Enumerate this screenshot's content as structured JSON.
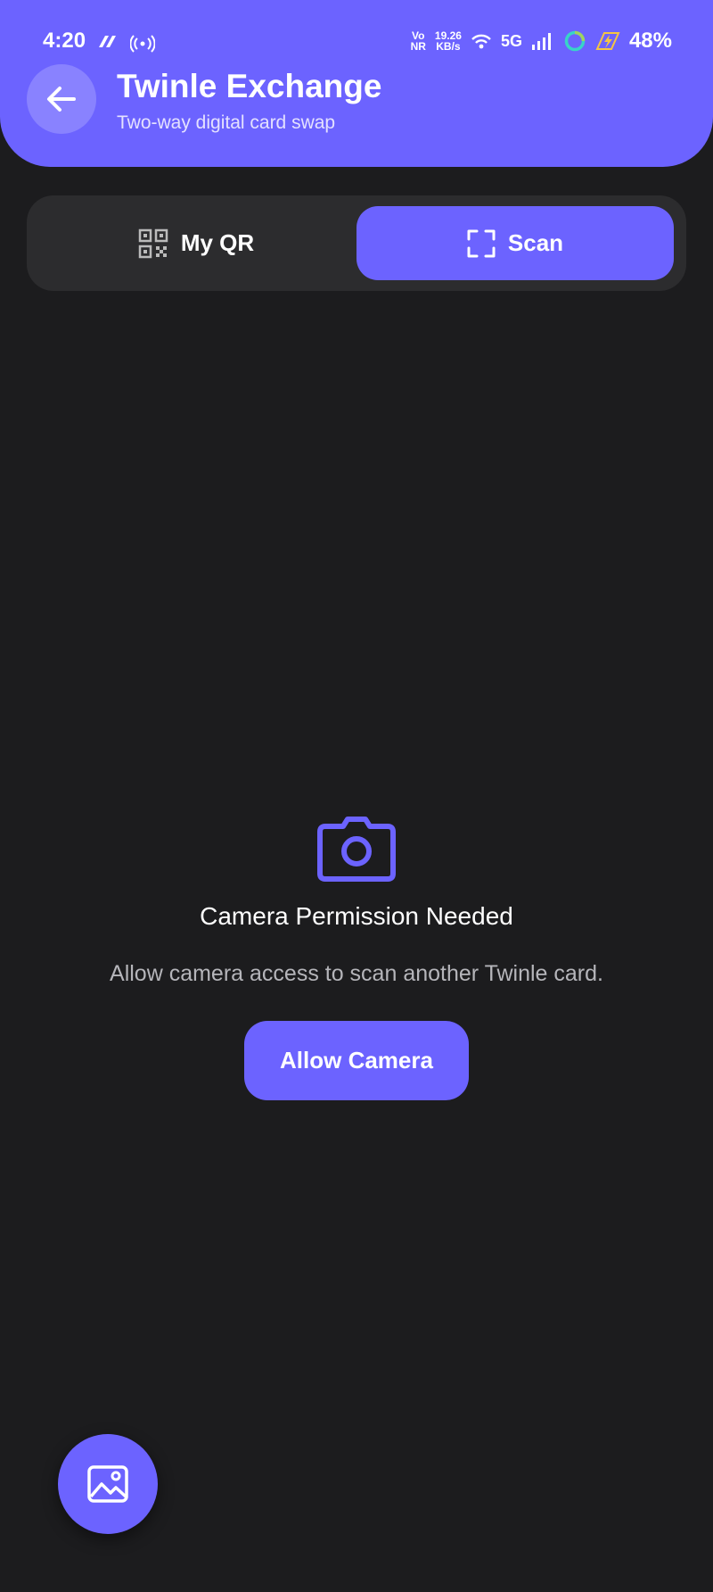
{
  "status_bar": {
    "time": "4:20",
    "network_type_top": "Vo",
    "network_type_bottom": "NR",
    "speed_value": "19.26",
    "speed_unit": "KB/s",
    "cellular": "5G",
    "battery": "48%"
  },
  "header": {
    "back_icon": "arrow-left-icon",
    "title": "Twinle Exchange",
    "subtitle": "Two-way digital card swap"
  },
  "tabs": [
    {
      "label": "My QR",
      "icon": "qr-code-icon",
      "active": false
    },
    {
      "label": "Scan",
      "icon": "scan-frame-icon",
      "active": true
    }
  ],
  "empty_state": {
    "icon": "camera-icon",
    "title": "Camera Permission Needed",
    "description": "Allow camera access to scan another Twinle card.",
    "button_label": "Allow Camera"
  },
  "fab": {
    "icon": "image-add-icon"
  },
  "colors": {
    "accent": "#6c63ff",
    "background": "#1c1c1e",
    "tab_track": "#2c2c2e",
    "muted_text": "#b5b5ba"
  }
}
